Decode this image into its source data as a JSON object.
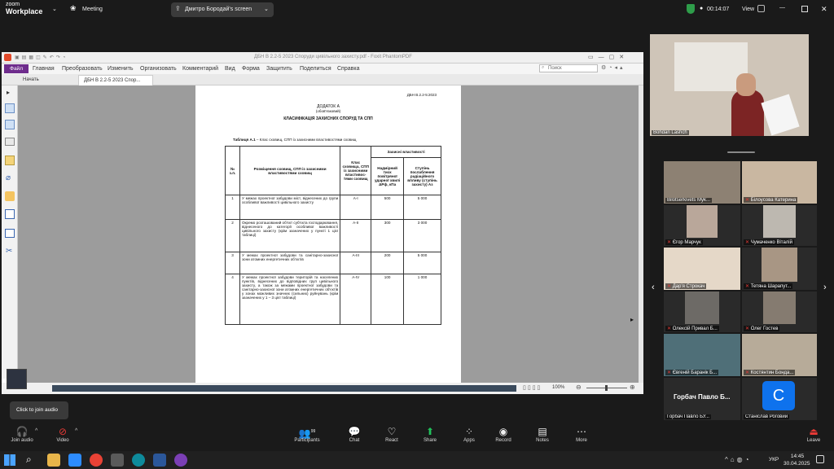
{
  "zoom": {
    "logo_top": "zoom",
    "logo_bottom": "Workplace",
    "meeting_label": "Meeting",
    "share_label": "Дмитро Бородай's screen",
    "timer": "00:14:07",
    "view_label": "View"
  },
  "pdf": {
    "window_title": "ДБН В 2.2-5 2023 Споруди цивільного захисту.pdf - Foxit PhantomPDF",
    "menu": [
      "Файл",
      "Главная",
      "Преобразовать",
      "Изменить",
      "Организовать",
      "Комментарий",
      "Вид",
      "Форма",
      "Защитить",
      "Поделиться",
      "Справка"
    ],
    "search_placeholder": "Поиск",
    "tab_start": "Начать",
    "tab_doc": "ДБН В 2.2-5 2023 Спор...",
    "zoom_level": "100%"
  },
  "doc": {
    "header_code": "ДБН В.2.2-5:2023",
    "appendix": "ДОДАТОК А",
    "mandatory": "(обов'язковий)",
    "title": "КЛАСИФІКАЦІЯ ЗАХИСНИХ СПОРУД ТА СПП",
    "table_caption_bold": "Таблиця А.1",
    "table_caption": " – Клас сховищ, СПП із захисними властивостями сховищ",
    "col_no": "№ з.п.",
    "col_location": "Розміщення сховищ, СПП із захисними властивостями сховищ",
    "col_class": "Клас сховища, СПП із захисними властивос-тями сховищ",
    "col_props": "Захисні властивості",
    "col_pressure": "Надмірний тиск повітряної ударної хвилі ΔPф, кПа",
    "col_degree": "Ступінь послаблення радіаційного впливу (ступінь захисту) Aз",
    "rows": [
      {
        "no": "1",
        "text": "У межах проектної забудови міст, віднесених до групи особливої важливості цивільного захисту",
        "cls": "А-І",
        "p": "500",
        "deg": "5 000"
      },
      {
        "no": "2",
        "text": "Окремо розташований об'єкт суб'єкта господарювання, віднесеного до категорії особливої важливості цивільного захисту (крім зазначених у пункті 1 цієї таблиці)",
        "cls": "А-ІІ",
        "p": "300",
        "deg": "3 000"
      },
      {
        "no": "3",
        "text": "У межах проектної забудови та санітарно-захисної зони атомних енергетичних об'єктів",
        "cls": "А-ІІІ",
        "p": "200",
        "deg": "5 000"
      },
      {
        "no": "4",
        "text": "У межах проектної забудови територій та населених пунктів, віднесених до відповідних груп цивільного захисту, а також за межами проектної забудови та санітарно-захисної зони атомних енергетичних об'єктів у зонах можливих значних (сильних) руйнувань (крім зазначених у 1 – 3 цієї таблиці)",
        "cls": "А-IV",
        "p": "100",
        "deg": "1 000"
      }
    ]
  },
  "participants": {
    "speaker": "Bohdan Lashch",
    "tiles": [
      "Bilotserkivets Myk...",
      "Білоусова Катерина",
      "Єгор Марчук",
      "Чумаченко Віталій",
      "Дар'я Строкач",
      "Тетяна Шарапут...",
      "Олексій Привал Б...",
      "Олег Гостев",
      "Євгеній Баранік Б...",
      "Костянтин Бонда..."
    ],
    "big_name": "Горбач Павло Б...",
    "name_bottom_left": "Горбач Павло БУ...",
    "name_bottom_right": "Станіслав Роговий",
    "avatar_letter": "C"
  },
  "bottom": {
    "join_audio_tooltip": "Click to join audio",
    "items": [
      "Join audio",
      "Video",
      "Participants",
      "Chat",
      "React",
      "Share",
      "Apps",
      "Record",
      "Notes",
      "More",
      "Leave"
    ],
    "participants_count": "99"
  },
  "taskbar": {
    "lang": "УКР",
    "time": "14:45",
    "date": "30.04.2025"
  }
}
